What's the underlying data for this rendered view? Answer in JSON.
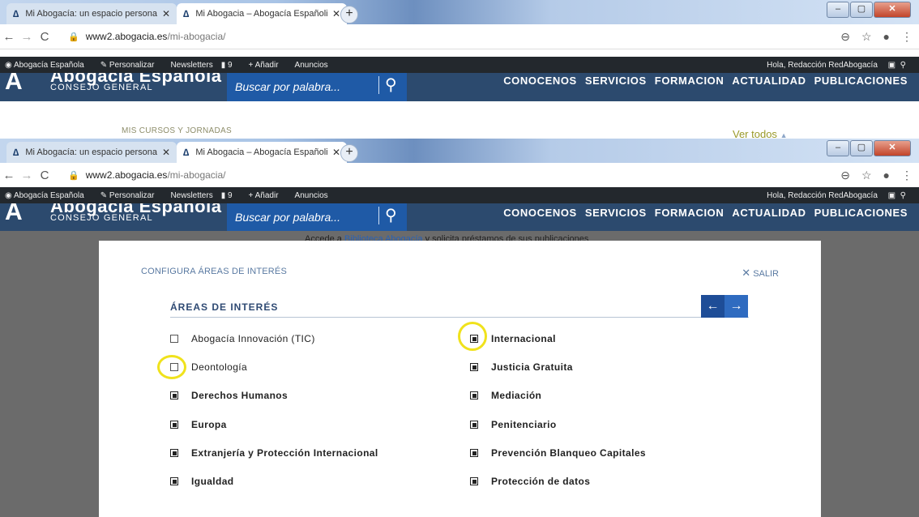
{
  "browser": {
    "tabs": [
      {
        "label": "Mi Abogacía: un espacio persona",
        "active": false
      },
      {
        "label": "Mi Abogacia – Abogacía Españoli",
        "active": true
      }
    ],
    "new_tab_icon": "plus-icon",
    "url_host": "www2.abogacia.es",
    "url_path": "/mi-abogacia/",
    "window_buttons": [
      "minimize",
      "maximize",
      "close"
    ]
  },
  "adminbar": {
    "items": [
      "Abogacía Española",
      "Personalizar",
      "Newsletters",
      "9",
      "Añadir",
      "Anuncios"
    ],
    "greeting": "Hola, Redacción RedAbogacía"
  },
  "site": {
    "logo_mark": "A",
    "logo_title": "Abogacía Española",
    "logo_subtitle": "CONSEJO GENERAL",
    "search_placeholder": "Buscar por palabra...",
    "menu": [
      "CONOCENOS",
      "SERVICIOS",
      "FORMACION",
      "ACTUALIDAD",
      "PUBLICACIONES"
    ]
  },
  "underlay": {
    "section_label": "MIS CURSOS Y JORNADAS",
    "see_all": "Ver todos",
    "see_all_arrow": "▲",
    "notice_prefix": "Accede a ",
    "notice_link": "Biblioteca Abogacía",
    "notice_suffix": " y solicita préstamos de sus publicaciones"
  },
  "modal": {
    "title": "CONFIGURA ÁREAS DE INTERÉS",
    "close_label": "SALIR",
    "heading": "ÁREAS DE INTERÉS",
    "prev_arrow": "←",
    "next_arrow": "→",
    "left_options": [
      {
        "label": "Abogacía Innovación (TIC)",
        "checked": false
      },
      {
        "label": "Deontología",
        "checked": false
      },
      {
        "label": "Derechos Humanos",
        "checked": true
      },
      {
        "label": "Europa",
        "checked": true
      },
      {
        "label": "Extranjería y Protección Internacional",
        "checked": true
      },
      {
        "label": "Igualdad",
        "checked": true
      }
    ],
    "right_options": [
      {
        "label": "Internacional",
        "checked": true
      },
      {
        "label": "Justicia Gratuita",
        "checked": true
      },
      {
        "label": "Mediación",
        "checked": true
      },
      {
        "label": "Penitenciario",
        "checked": true
      },
      {
        "label": "Prevención Blanqueo Capitales",
        "checked": true
      },
      {
        "label": "Protección de datos",
        "checked": true
      }
    ]
  },
  "annotations": {
    "highlight_color": "#f0e21c"
  }
}
